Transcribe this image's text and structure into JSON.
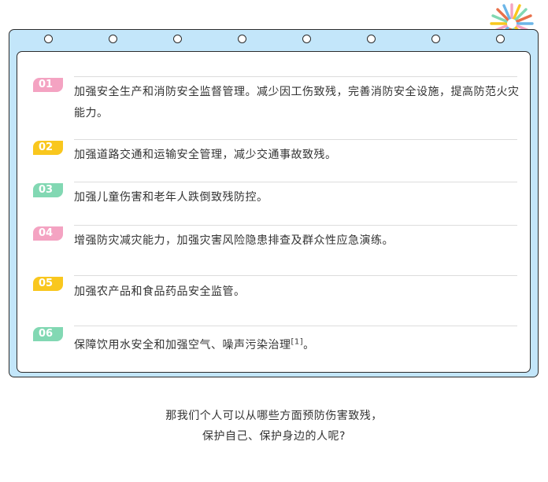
{
  "measures": [
    {
      "number": "01",
      "text": "加强安全生产和消防安全监督管理。减少因工伤致残，完善消防安全设施，提高防范火灾能力。",
      "tag_color": "#f4a3c2"
    },
    {
      "number": "02",
      "text": "加强道路交通和运输安全管理，减少交通事故致残。",
      "tag_color": "#f9c71e"
    },
    {
      "number": "03",
      "text": "加强儿童伤害和老年人跌倒致残防控。",
      "tag_color": "#82d8b3"
    },
    {
      "number": "04",
      "text": "增强防灾减灾能力，加强灾害风险隐患排查及群众性应急演练。",
      "tag_color": "#f4a3c2"
    },
    {
      "number": "05",
      "text": "加强农产品和食品药品安全监管。",
      "tag_color": "#f9c71e"
    },
    {
      "number": "06",
      "text": "保障饮用水安全和加强空气、噪声污染治理",
      "citation": "[1]",
      "tail": "。",
      "tag_color": "#82d8b3"
    }
  ],
  "footer": {
    "line1": "那我们个人可以从哪些方面预防伤害致残，",
    "line2": "保护自己、保护身边的人呢?"
  },
  "colors": {
    "board": "#c3e6fa",
    "pink": "#f4a3c2",
    "yellow": "#f9c71e",
    "green": "#82d8b3"
  },
  "decoration": "sunburst-icon"
}
